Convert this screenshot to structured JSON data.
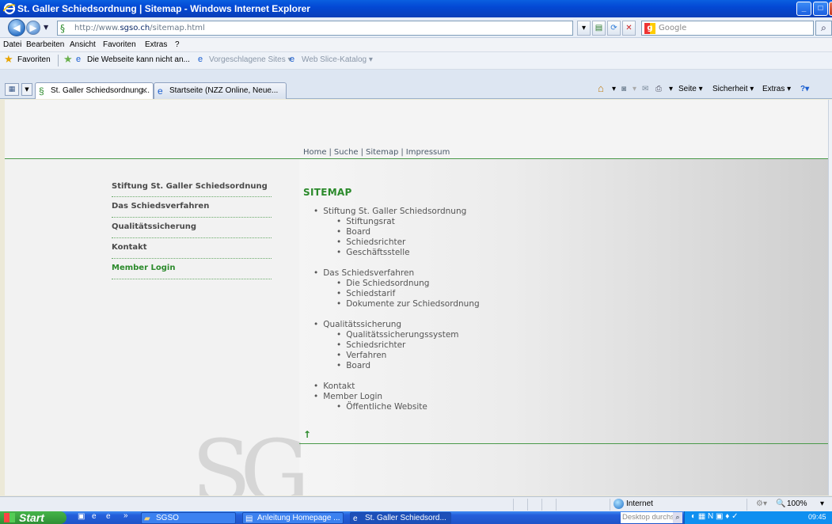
{
  "window": {
    "title": "St. Galler Schiedsordnung | Sitemap - Windows Internet Explorer",
    "min": "_",
    "max": "□",
    "close": "X"
  },
  "address": {
    "url_prefix": "http://www.",
    "url_domain": "sgso.ch",
    "url_path": "/sitemap.html",
    "search_placeholder": "Google"
  },
  "menu": [
    "Datei",
    "Bearbeiten",
    "Ansicht",
    "Favoriten",
    "Extras",
    "?"
  ],
  "favorites": {
    "label": "Favoriten",
    "items": [
      "Die Webseite kann nicht an...",
      "Vorgeschlagene Sites ▾",
      "Web Slice-Katalog ▾"
    ]
  },
  "tabs": [
    {
      "label": "St. Galler Schiedsordnung...",
      "close": "✕"
    },
    {
      "label": "Startseite (NZZ Online, Neue..."
    }
  ],
  "commandbar": {
    "seite": "Seite ▾",
    "sicherheit": "Sicherheit ▾",
    "extras": "Extras ▾"
  },
  "site": {
    "topnav": [
      "Home",
      "Suche",
      "Sitemap",
      "Impressum"
    ],
    "leftnav": [
      "Stiftung St. Galler Schiedsordnung",
      "Das Schiedsverfahren",
      "Qualitätssicherung",
      "Kontakt",
      "Member Login"
    ],
    "sitemap_title": "SITEMAP",
    "sitemap": [
      {
        "label": "Stiftung St. Galler Schiedsordnung",
        "children": [
          "Stiftungsrat",
          "Board",
          "Schiedsrichter",
          "Geschäftsstelle"
        ]
      },
      {
        "label": "Das Schiedsverfahren",
        "children": [
          "Die Schiedsordnung",
          "Schiedstarif",
          "Dokumente zur Schiedsordnung"
        ]
      },
      {
        "label": "Qualitätssicherung",
        "children": [
          "Qualitätssicherungssystem",
          "Schiedsrichter",
          "Verfahren",
          "Board"
        ]
      },
      {
        "label": "Kontakt",
        "children": []
      },
      {
        "label": "Member Login",
        "children": [
          "Öffentliche Website"
        ]
      }
    ],
    "up_arrow": "↑",
    "watermark": "SG"
  },
  "status": {
    "zone": "Internet",
    "zoom": "100%"
  },
  "taskbar": {
    "start": "Start",
    "chevron": "»",
    "tasks": [
      "SGSO",
      "Anleitung Homepage ...",
      "St. Galler Schiedsord..."
    ],
    "desktop_search": "Desktop durchsuchen",
    "clock": "09:45"
  },
  "colors": {
    "accent_green": "#2b8a2b",
    "xp_blue": "#0348d4"
  }
}
